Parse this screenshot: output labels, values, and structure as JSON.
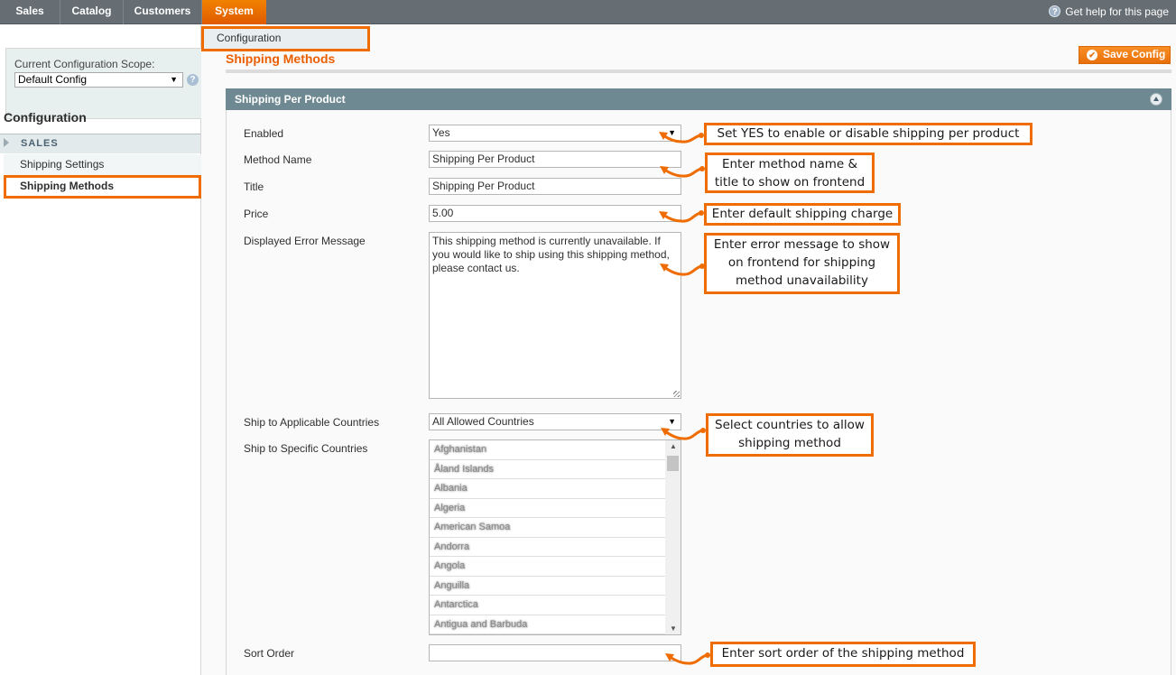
{
  "topnav": {
    "items": [
      {
        "label": "Sales"
      },
      {
        "label": "Catalog"
      },
      {
        "label": "Customers"
      },
      {
        "label": "System",
        "selected": true
      }
    ],
    "help_label": "Get help for this page",
    "dropdown_item": "Configuration"
  },
  "sidebar": {
    "scope_label": "Current Configuration Scope:",
    "scope_value": "Default Config",
    "title": "Configuration",
    "group": "SALES",
    "links": [
      {
        "label": "Shipping Settings"
      },
      {
        "label": "Shipping Methods",
        "active": true
      }
    ]
  },
  "main": {
    "page_title": "Shipping Methods",
    "save_label": "Save Config",
    "section_title": "Shipping Per Product",
    "fields": {
      "enabled": {
        "label": "Enabled",
        "value": "Yes"
      },
      "method_name": {
        "label": "Method Name",
        "value": "Shipping Per Product"
      },
      "title": {
        "label": "Title",
        "value": "Shipping Per Product"
      },
      "price": {
        "label": "Price",
        "value": "5.00"
      },
      "error_message": {
        "label": "Displayed Error Message",
        "value": "This shipping method is currently unavailable. If you would like to ship using this shipping method, please contact us."
      },
      "applicable_countries": {
        "label": "Ship to Applicable Countries",
        "value": "All Allowed Countries"
      },
      "specific_countries": {
        "label": "Ship to Specific Countries",
        "options": [
          "Afghanistan",
          "Åland Islands",
          "Albania",
          "Algeria",
          "American Samoa",
          "Andorra",
          "Angola",
          "Anguilla",
          "Antarctica",
          "Antigua and Barbuda"
        ]
      },
      "sort_order": {
        "label": "Sort Order",
        "value": ""
      }
    }
  },
  "annotations": {
    "enabled": "Set YES to enable or disable shipping per product",
    "name_title_1": "Enter method name &",
    "name_title_2": "title to show on frontend",
    "price": "Enter default shipping charge",
    "error_1": "Enter error message to show",
    "error_2": "on frontend for shipping",
    "error_3": "method unavailability",
    "countries_1": "Select countries to allow",
    "countries_2": "shipping method",
    "sort": "Enter sort order of the shipping method"
  },
  "colors": {
    "accent": "#ef6c00",
    "nav_bg": "#666e73",
    "section_header": "#6f8992",
    "title_orange": "#eb5e00"
  }
}
